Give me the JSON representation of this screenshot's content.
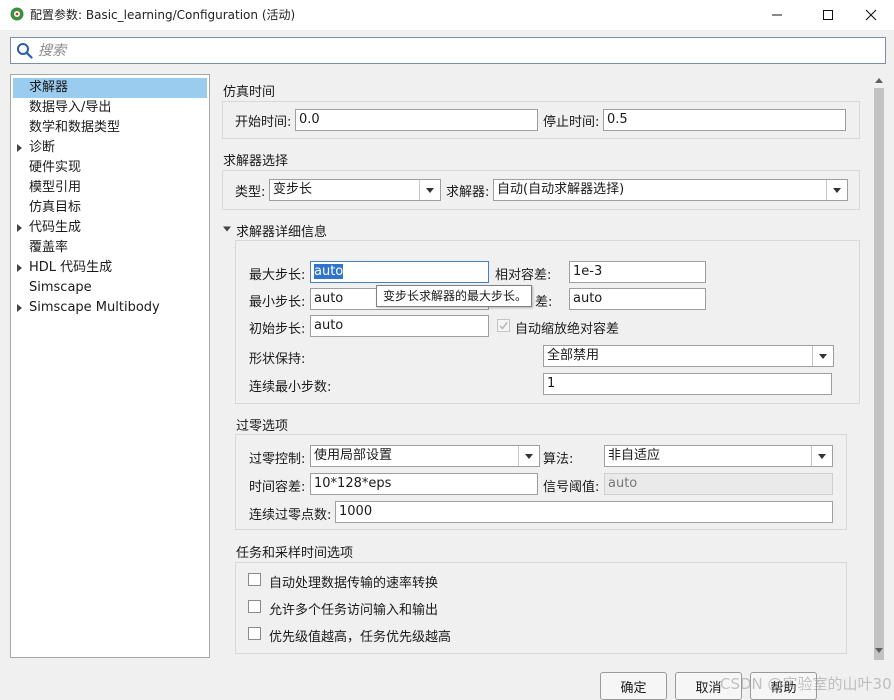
{
  "window": {
    "title": "配置参数: Basic_learning/Configuration (活动)",
    "icon": "simulink-gear-icon"
  },
  "search": {
    "placeholder": "搜索"
  },
  "tree": {
    "items": [
      {
        "label": "求解器",
        "selected": true,
        "expandable": false
      },
      {
        "label": "数据导入/导出",
        "selected": false,
        "expandable": false
      },
      {
        "label": "数学和数据类型",
        "selected": false,
        "expandable": false
      },
      {
        "label": "诊断",
        "selected": false,
        "expandable": true
      },
      {
        "label": "硬件实现",
        "selected": false,
        "expandable": false
      },
      {
        "label": "模型引用",
        "selected": false,
        "expandable": false
      },
      {
        "label": "仿真目标",
        "selected": false,
        "expandable": false
      },
      {
        "label": "代码生成",
        "selected": false,
        "expandable": true
      },
      {
        "label": "覆盖率",
        "selected": false,
        "expandable": false
      },
      {
        "label": "HDL 代码生成",
        "selected": false,
        "expandable": true
      },
      {
        "label": "Simscape",
        "selected": false,
        "expandable": false
      },
      {
        "label": "Simscape Multibody",
        "selected": false,
        "expandable": true
      }
    ]
  },
  "sim_time": {
    "title": "仿真时间",
    "start_label": "开始时间:",
    "start_value": "0.0",
    "stop_label": "停止时间:",
    "stop_value": "0.5"
  },
  "solver_select": {
    "title": "求解器选择",
    "type_label": "类型:",
    "type_value": "变步长",
    "solver_label": "求解器:",
    "solver_value": "自动(自动求解器选择)"
  },
  "solver_details": {
    "title": "求解器详细信息",
    "max_step_label": "最大步长:",
    "max_step_value": "auto",
    "rel_tol_label": "相对容差:",
    "rel_tol_value": "1e-3",
    "min_step_label": "最小步长:",
    "min_step_value": "auto",
    "abs_tol_label_tail": "差:",
    "abs_tol_value": "auto",
    "init_step_label": "初始步长:",
    "init_step_value": "auto",
    "auto_scale_label": "自动缩放绝对容差",
    "shape_label": "形状保持:",
    "shape_value": "全部禁用",
    "consec_min_label": "连续最小步数:",
    "consec_min_value": "1",
    "tooltip": "变步长求解器的最大步长。"
  },
  "zero_crossing": {
    "title": "过零选项",
    "control_label": "过零控制:",
    "control_value": "使用局部设置",
    "algo_label": "算法:",
    "algo_value": "非自适应",
    "time_tol_label": "时间容差:",
    "time_tol_value": "10*128*eps",
    "signal_thresh_label": "信号阈值:",
    "signal_thresh_value": "auto",
    "consec_label": "连续过零点数:",
    "consec_value": "1000"
  },
  "tasks": {
    "title": "任务和采样时间选项",
    "options": [
      {
        "label": "自动处理数据传输的速率转换",
        "checked": false
      },
      {
        "label": "允许多个任务访问输入和输出",
        "checked": false
      },
      {
        "label": "优先级值越高，任务优先级越高",
        "checked": false
      }
    ]
  },
  "buttons": {
    "ok": "确定",
    "cancel": "取消",
    "help": "帮助"
  },
  "watermark": "CSDN @实验室的山叶30"
}
